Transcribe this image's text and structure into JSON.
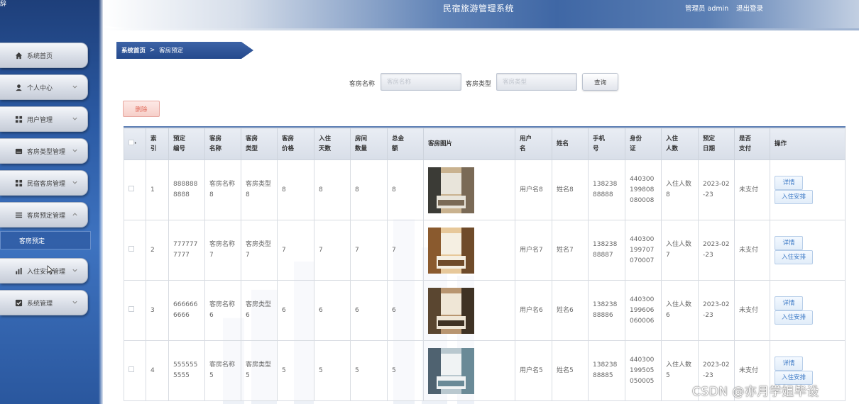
{
  "header": {
    "title": "民宿旅游管理系统",
    "user": "管理员 admin",
    "logout": "退出登录"
  },
  "sidebar": {
    "brand_fragment": "辞",
    "items": [
      {
        "label": "系统首页",
        "icon": "home-icon",
        "expandable": false
      },
      {
        "label": "个人中心",
        "icon": "person-icon",
        "expandable": true
      },
      {
        "label": "用户管理",
        "icon": "grid-icon",
        "expandable": true
      },
      {
        "label": "客房类型管理",
        "icon": "card-icon",
        "expandable": true
      },
      {
        "label": "民宿客房管理",
        "icon": "grid-icon",
        "expandable": true
      },
      {
        "label": "客房预定管理",
        "icon": "list-icon",
        "expandable": true,
        "expanded": true
      }
    ],
    "submenu_active": "客房预定",
    "items_after": [
      {
        "label": "入住安排管理",
        "icon": "bar-chart-icon",
        "expandable": true
      },
      {
        "label": "系统管理",
        "icon": "checkbox-icon",
        "expandable": true
      }
    ]
  },
  "breadcrumb": {
    "home": "系统首页",
    "separator": ">",
    "current": "客房预定"
  },
  "search": {
    "room_name_label": "客房名称",
    "room_name_placeholder": "客房名称",
    "room_type_label": "客房类型",
    "room_type_placeholder": "客房类型",
    "query_button": "查询"
  },
  "actions": {
    "delete_button": "删除"
  },
  "table": {
    "columns": [
      "索引",
      "预定编号",
      "客房名称",
      "客房类型",
      "客房价格",
      "入住天数",
      "房间数量",
      "总金额",
      "客房图片",
      "用户名",
      "姓名",
      "手机号",
      "身份证",
      "入住人数",
      "预定日期",
      "是否支付",
      "操作"
    ],
    "header_display": [
      "索\n引",
      "预定\n编号",
      "客房\n名称",
      "客房\n类型",
      "客房\n价格",
      "入住\n天数",
      "房间\n数量",
      "总金\n额",
      "客房图片",
      "用户\n名",
      "姓名",
      "手机\n号",
      "身份\n证",
      "入住\n人数",
      "预定\n日期",
      "是否\n支付",
      "操作"
    ],
    "rows": [
      {
        "index": "1",
        "booking_no": "8888888888",
        "room_name": "客房名称8",
        "room_type": "客房类型8",
        "price": "8",
        "days": "8",
        "rooms": "8",
        "total": "8",
        "username": "用户名8",
        "name": "姓名8",
        "phone": "13823888888",
        "id_card": "440300199808080008",
        "guests": "入住人数8",
        "date": "2023-02-23",
        "paid": "未支付"
      },
      {
        "index": "2",
        "booking_no": "7777777777",
        "room_name": "客房名称7",
        "room_type": "客房类型7",
        "price": "7",
        "days": "7",
        "rooms": "7",
        "total": "7",
        "username": "用户名7",
        "name": "姓名7",
        "phone": "13823888887",
        "id_card": "440300199707070007",
        "guests": "入住人数7",
        "date": "2023-02-23",
        "paid": "未支付"
      },
      {
        "index": "3",
        "booking_no": "6666666666",
        "room_name": "客房名称6",
        "room_type": "客房类型6",
        "price": "6",
        "days": "6",
        "rooms": "6",
        "total": "6",
        "username": "用户名6",
        "name": "姓名6",
        "phone": "13823888886",
        "id_card": "440300199606060006",
        "guests": "入住人数6",
        "date": "2023-02-23",
        "paid": "未支付"
      },
      {
        "index": "4",
        "booking_no": "5555555555",
        "room_name": "客房名称5",
        "room_type": "客房类型5",
        "price": "5",
        "days": "5",
        "rooms": "5",
        "total": "5",
        "username": "用户名5",
        "name": "姓名5",
        "phone": "13823888885",
        "id_card": "440300199505050005",
        "guests": "入住人数5",
        "date": "2023-02-23",
        "paid": "未支付"
      }
    ],
    "op_detail": "详情",
    "op_arrange": "入住安排"
  },
  "watermark": "CSDN @亦月学姐毕设",
  "colors": {
    "accent": "#2b5aa3",
    "header_dark": "#3f67a5",
    "delete": "#e06a5a",
    "link_button": "#3d7ac6"
  }
}
